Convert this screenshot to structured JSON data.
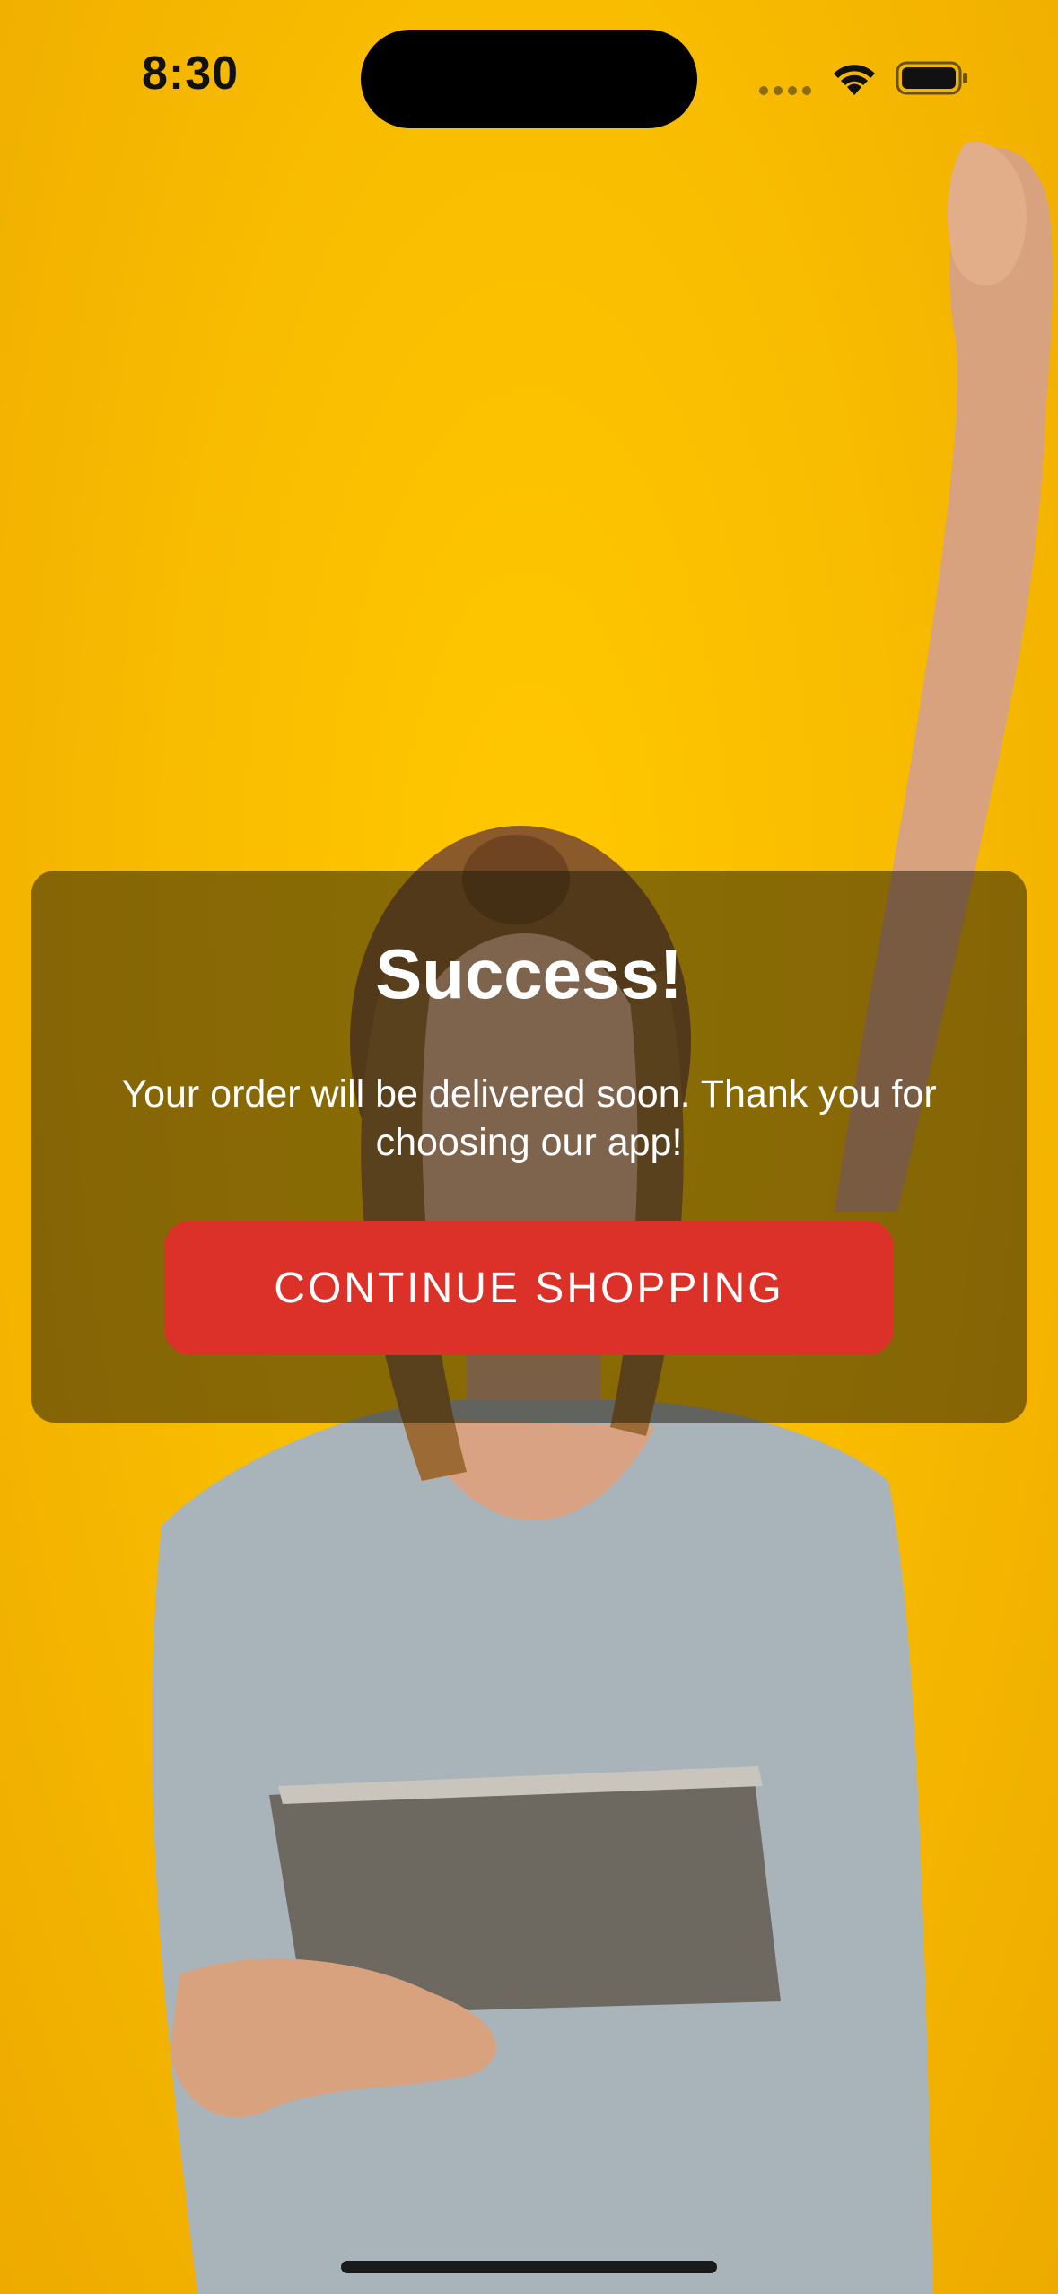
{
  "status_bar": {
    "time": "8:30",
    "icons": [
      "cellular-signal-icon",
      "wifi-icon",
      "battery-icon"
    ]
  },
  "background": {
    "description_icon": "celebrating-woman-with-tablet-photo",
    "color": "#f9bd00"
  },
  "dialog": {
    "title": "Success!",
    "message": "Your order will be delivered soon. Thank you for choosing our app!",
    "button_label": "CONTINUE SHOPPING",
    "button_color": "#dc3128"
  }
}
